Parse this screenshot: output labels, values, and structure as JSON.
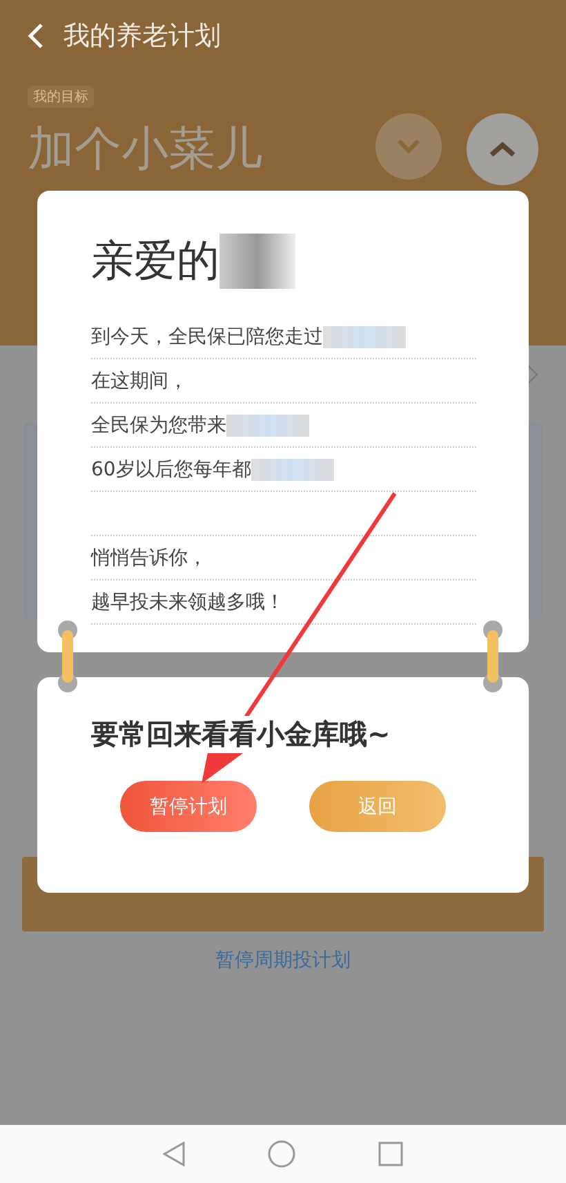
{
  "header": {
    "title": "我的养老计划",
    "goal_tag": "我的目标",
    "goal_name": "加个小菜儿"
  },
  "link": "暂停周期投计划",
  "dialog": {
    "greeting": "亲爱的",
    "lines": [
      {
        "kind": "redacted",
        "text": "到今天，全民保已陪您走过"
      },
      {
        "kind": "text",
        "text": "在这期间，"
      },
      {
        "kind": "redacted",
        "text": "全民保为您带来"
      },
      {
        "kind": "redacted",
        "text": "60岁以后您每年都"
      },
      {
        "kind": "blank"
      },
      {
        "kind": "text",
        "text": "悄悄告诉你，"
      },
      {
        "kind": "text",
        "text": "越早投未来领越多哦！"
      }
    ],
    "footer_title": "要常回来看看小金库哦~",
    "buttons": [
      {
        "label": "暂停计划",
        "kind": "primary"
      },
      {
        "label": "返回",
        "kind": "secondary"
      }
    ]
  }
}
